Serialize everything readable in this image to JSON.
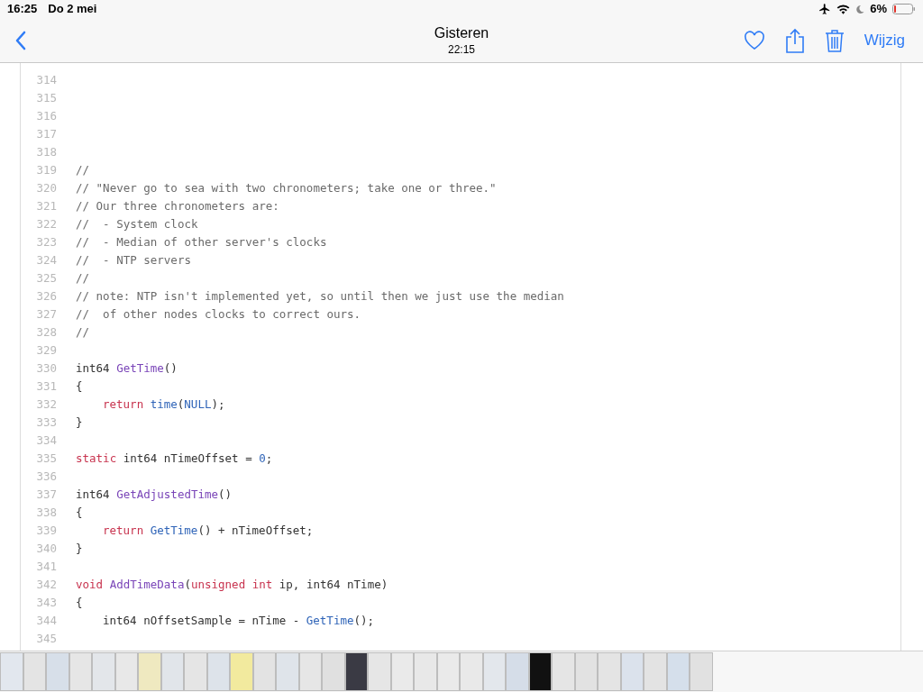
{
  "status_bar": {
    "time": "16:25",
    "date": "Do 2 mei",
    "battery": "6%"
  },
  "nav": {
    "title": "Gisteren",
    "subtitle": "22:15",
    "edit": "Wijzig"
  },
  "code": [
    {
      "number": "314"
    },
    {
      "number": "315"
    },
    {
      "number": "316"
    },
    {
      "number": "317"
    },
    {
      "number": "318"
    },
    {
      "number": "319",
      "indented": false,
      "tokens": [
        {
          "kind": "comment",
          "text": "//"
        }
      ]
    },
    {
      "number": "320",
      "indented": false,
      "tokens": [
        {
          "kind": "comment",
          "text": "// \"Never go to sea with two chronometers; take one or three.\""
        }
      ]
    },
    {
      "number": "321",
      "indented": false,
      "tokens": [
        {
          "kind": "comment",
          "text": "// Our three chronometers are:"
        }
      ]
    },
    {
      "number": "322",
      "indented": false,
      "tokens": [
        {
          "kind": "comment",
          "text": "//  - System clock"
        }
      ]
    },
    {
      "number": "323",
      "indented": false,
      "tokens": [
        {
          "kind": "comment",
          "text": "//  - Median of other server's clocks"
        }
      ]
    },
    {
      "number": "324",
      "indented": false,
      "tokens": [
        {
          "kind": "comment",
          "text": "//  - NTP servers"
        }
      ]
    },
    {
      "number": "325",
      "indented": false,
      "tokens": [
        {
          "kind": "comment",
          "text": "//"
        }
      ]
    },
    {
      "number": "326",
      "indented": false,
      "tokens": [
        {
          "kind": "comment",
          "text": "// note: NTP isn't implemented yet, so until then we just use the median"
        }
      ]
    },
    {
      "number": "327",
      "indented": false,
      "tokens": [
        {
          "kind": "comment",
          "text": "//  of other nodes clocks to correct ours."
        }
      ]
    },
    {
      "number": "328",
      "indented": false,
      "tokens": [
        {
          "kind": "comment",
          "text": "//"
        }
      ]
    },
    {
      "number": "329"
    },
    {
      "number": "330",
      "indented": false,
      "tokens": [
        {
          "kind": "plain",
          "text": "int64 "
        },
        {
          "kind": "def",
          "text": "GetTime"
        },
        {
          "kind": "plain",
          "text": "()"
        }
      ]
    },
    {
      "number": "331",
      "indented": false,
      "tokens": [
        {
          "kind": "plain",
          "text": "{"
        }
      ]
    },
    {
      "number": "332",
      "indented": true,
      "tokens": [
        {
          "kind": "keyword",
          "text": "return "
        },
        {
          "kind": "call",
          "text": "time"
        },
        {
          "kind": "plain",
          "text": "("
        },
        {
          "kind": "call",
          "text": "NULL"
        },
        {
          "kind": "plain",
          "text": ");"
        }
      ]
    },
    {
      "number": "333",
      "indented": false,
      "tokens": [
        {
          "kind": "plain",
          "text": "}"
        }
      ]
    },
    {
      "number": "334"
    },
    {
      "number": "335",
      "indented": false,
      "tokens": [
        {
          "kind": "keyword",
          "text": "static "
        },
        {
          "kind": "plain",
          "text": "int64 nTimeOffset = "
        },
        {
          "kind": "call",
          "text": "0"
        },
        {
          "kind": "plain",
          "text": ";"
        }
      ]
    },
    {
      "number": "336"
    },
    {
      "number": "337",
      "indented": false,
      "tokens": [
        {
          "kind": "plain",
          "text": "int64 "
        },
        {
          "kind": "def",
          "text": "GetAdjustedTime"
        },
        {
          "kind": "plain",
          "text": "()"
        }
      ]
    },
    {
      "number": "338",
      "indented": false,
      "tokens": [
        {
          "kind": "plain",
          "text": "{"
        }
      ]
    },
    {
      "number": "339",
      "indented": true,
      "tokens": [
        {
          "kind": "keyword",
          "text": "return "
        },
        {
          "kind": "call",
          "text": "GetTime"
        },
        {
          "kind": "plain",
          "text": "() + nTimeOffset;"
        }
      ]
    },
    {
      "number": "340",
      "indented": false,
      "tokens": [
        {
          "kind": "plain",
          "text": "}"
        }
      ]
    },
    {
      "number": "341"
    },
    {
      "number": "342",
      "indented": false,
      "tokens": [
        {
          "kind": "keyword",
          "text": "void "
        },
        {
          "kind": "def",
          "text": "AddTimeData"
        },
        {
          "kind": "plain",
          "text": "("
        },
        {
          "kind": "keyword",
          "text": "unsigned int "
        },
        {
          "kind": "plain",
          "text": "ip, int64 nTime)"
        }
      ]
    },
    {
      "number": "343",
      "indented": false,
      "tokens": [
        {
          "kind": "plain",
          "text": "{"
        }
      ]
    },
    {
      "number": "344",
      "indented": true,
      "tokens": [
        {
          "kind": "plain",
          "text": "int64 nOffsetSample = nTime - "
        },
        {
          "kind": "call",
          "text": "GetTime"
        },
        {
          "kind": "plain",
          "text": "();"
        }
      ]
    },
    {
      "number": "345"
    }
  ]
}
